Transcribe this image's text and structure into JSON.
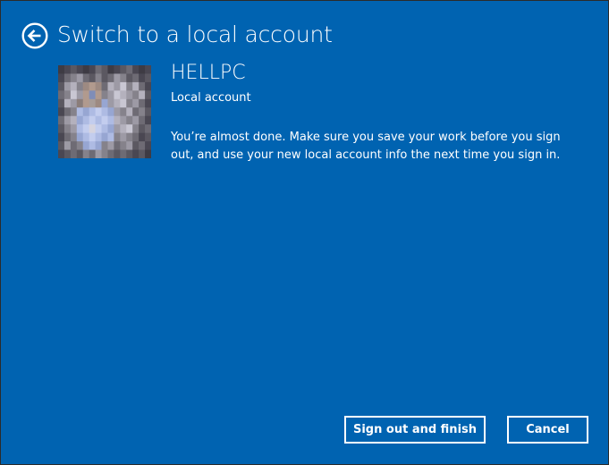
{
  "header": {
    "back_icon": "back-arrow-circle-icon",
    "title": "Switch to a local account"
  },
  "account": {
    "avatar_icon": "user-avatar-pixelated",
    "name": "HELLPC",
    "type_label": "Local account"
  },
  "message": {
    "text": "You’re almost done. Make sure you save your work before you sign out, and use your new local account info the next time you sign in."
  },
  "actions": {
    "sign_out_label": "Sign out and finish",
    "cancel_label": "Cancel"
  },
  "colors": {
    "background": "#0063b1",
    "text": "#ffffff",
    "border": "#2b2b2b"
  }
}
